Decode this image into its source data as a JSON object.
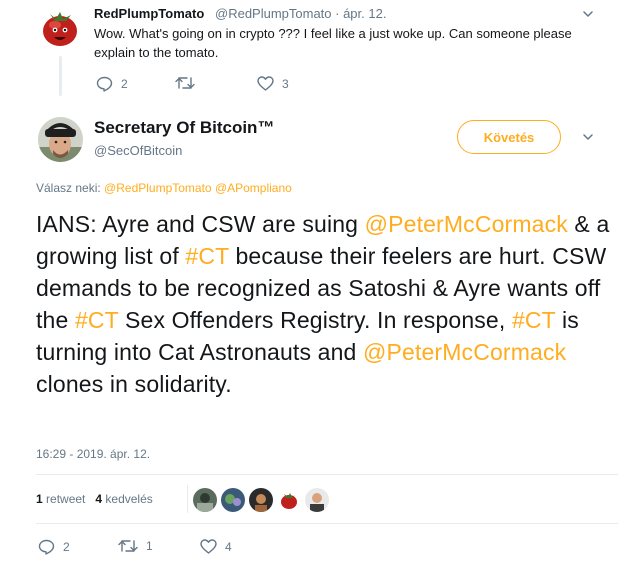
{
  "parent_tweet": {
    "display_name": "RedPlumpTomato",
    "meta": "@RedPlumpTomato · ápr. 12.",
    "text": "Wow. What's going on in crypto ???  I feel like a just woke up.  Can someone please explain to the tomato.",
    "replies": "2",
    "retweets": "",
    "likes": "3",
    "avatar_icon": "tomato-avatar-icon"
  },
  "main_tweet": {
    "display_name": "Secretary Of Bitcoin™",
    "handle": "@SecOfBitcoin",
    "follow_label": "Követés",
    "reply_prefix": "Válasz neki: ",
    "reply_mentions": "@RedPlumpTomato @APompliano",
    "text_parts": {
      "p1": "IANS: Ayre and CSW are suing ",
      "m1": "@PeterMcCormack",
      "p2": " & a growing list of ",
      "h1": "#CT",
      "p3": " because their feelers are hurt. CSW demands to be recognized as Satoshi & Ayre wants off the ",
      "h2": "#CT",
      "p4": " Sex Offenders Registry. In response, ",
      "h3": "#CT",
      "p5": " is turning into Cat Astronauts and ",
      "m2": "@PeterMcCormack",
      "p6": " clones in solidarity."
    },
    "timestamp": "16:29 - 2019. ápr. 12.",
    "retweet_count": "1",
    "retweet_label": " retweet",
    "like_count": "4",
    "like_label": " kedvelés",
    "replies": "2",
    "retweets": "1",
    "likes": "4"
  },
  "colors": {
    "accent": "#ffad1f",
    "secondary_text": "#657786",
    "primary_text": "#14171a",
    "divider": "#e6ecf0"
  }
}
